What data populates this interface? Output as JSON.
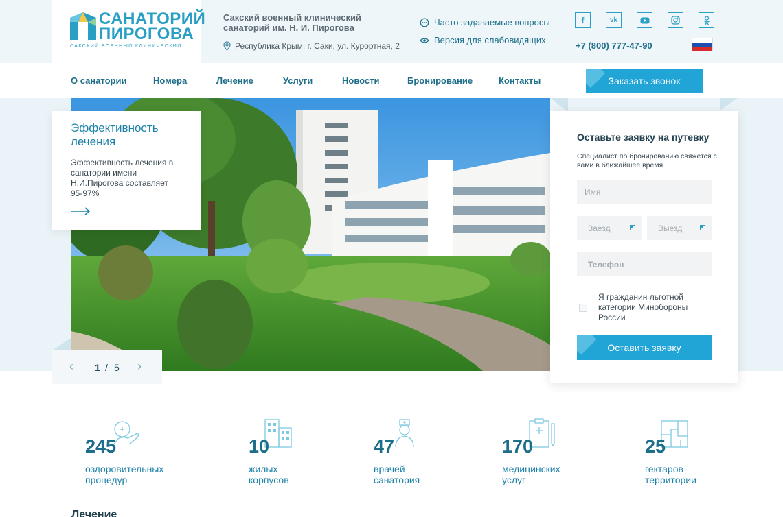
{
  "header": {
    "logo": {
      "line1": "САНАТОРИЙ",
      "line2": "ПИРОГОВА",
      "subtitle": "САКСКИЙ ВОЕННЫЙ КЛИНИЧЕСКИЙ"
    },
    "org_name": "Сакский военный клинический санаторий им. Н. И. Пирогова",
    "address": "Республика Крым, г. Саки, ул. Курортная, 2",
    "faq_link": "Часто задаваемые вопросы",
    "vision_link": "Версия для слабовидящих",
    "phone": "+7 (800) 777-47-90",
    "socials": [
      "facebook-icon",
      "vk-icon",
      "youtube-icon",
      "instagram-icon",
      "odnoklassniki-icon"
    ],
    "language_flag": "russian-flag"
  },
  "nav": {
    "items": [
      "О санатории",
      "Номера",
      "Лечение",
      "Услуги",
      "Новости",
      "Бронирование",
      "Контакты"
    ],
    "call_button": "Заказать звонок"
  },
  "slider": {
    "card_title": "Эффективность лечения",
    "card_text": "Эффективность лечения в санатории имени Н.И.Пирогова составляет 95-97%",
    "current": "1",
    "separator": "/",
    "total": "5"
  },
  "booking": {
    "title": "Оставьте заявку на путевку",
    "subtitle": "Специалист по бронированию свяжется с вами в ближайшее время",
    "name_placeholder": "Имя",
    "checkin_placeholder": "Заезд",
    "checkout_placeholder": "Выезд",
    "phone_placeholder": "Телефон",
    "checkbox_label": "Я гражданин льготной категории Минобороны России",
    "submit": "Оставить заявку"
  },
  "stats": [
    {
      "value": "245",
      "label1": "оздоровительных",
      "label2": "процедур",
      "icon": "hand-heart-icon"
    },
    {
      "value": "10",
      "label1": "жилых",
      "label2": "корпусов",
      "icon": "buildings-icon"
    },
    {
      "value": "47",
      "label1": "врачей",
      "label2": "санатория",
      "icon": "doctor-icon"
    },
    {
      "value": "170",
      "label1": "медицинских",
      "label2": "услуг",
      "icon": "clipboard-icon"
    },
    {
      "value": "25",
      "label1": "гектаров",
      "label2": "территории",
      "icon": "plan-icon"
    }
  ],
  "next_section_title": "Лечение",
  "colors": {
    "accent": "#20a5d6",
    "dark_blue": "#1d6e8a",
    "band": "#eaf3f7"
  }
}
